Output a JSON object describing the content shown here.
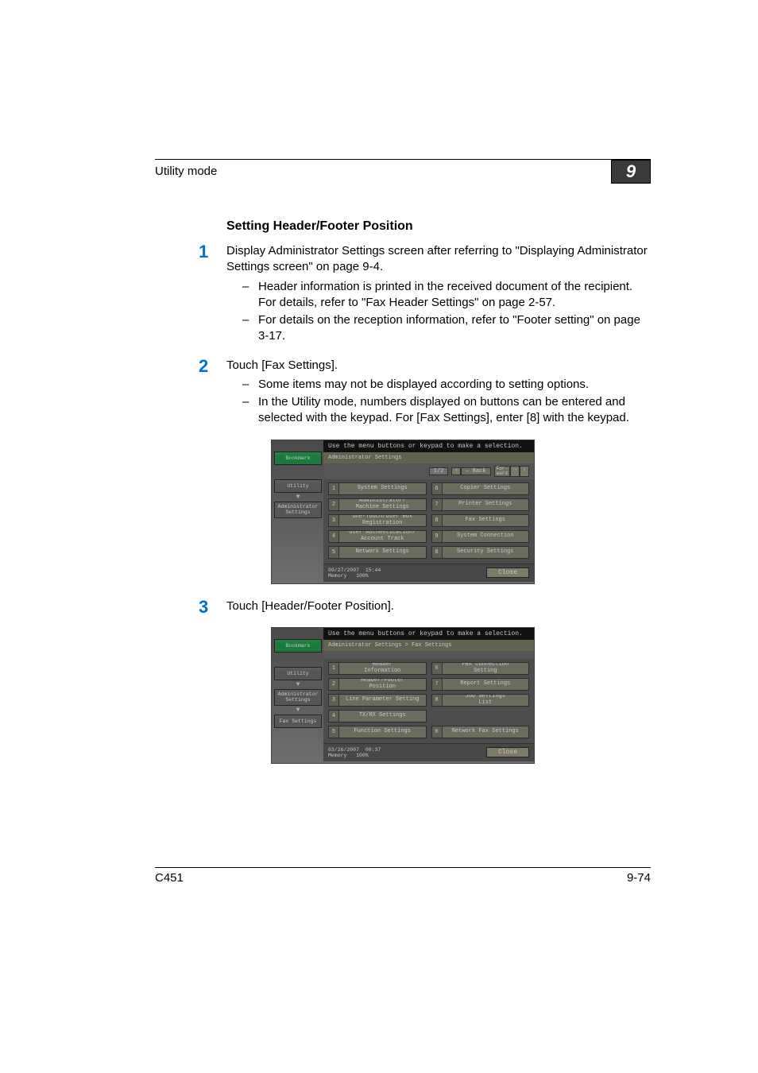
{
  "header": {
    "mode": "Utility mode",
    "chapter": "9"
  },
  "section_heading": "Setting Header/Footer Position",
  "steps": [
    {
      "n": "1",
      "body": "Display Administrator Settings screen after referring to \"Displaying Administrator Settings screen\" on page 9-4.",
      "subs": [
        "Header information is printed in the received document of the recipient. For details, refer to \"Fax Header Settings\" on page 2-57.",
        "For details on the reception information, refer to \"Footer setting\" on page 3-17."
      ]
    },
    {
      "n": "2",
      "body": "Touch [Fax Settings].",
      "subs": [
        "Some items may not be displayed according to setting options.",
        "In the Utility mode, numbers displayed on buttons can be entered and selected with the keypad. For [Fax Settings], enter [8] with the keypad."
      ]
    },
    {
      "n": "3",
      "body": "Touch [Header/Footer Position].",
      "subs": []
    }
  ],
  "shot_common": {
    "instruction": "Use the menu buttons or keypad to make a selection.",
    "bookmark": "Bookmark",
    "utility": "Utility",
    "admin": "Administrator Settings",
    "fax_settings": "Fax Settings",
    "back": "← Back",
    "forward_label": "For-\nward",
    "close": "Close",
    "memory_label": "Memory",
    "memory_value": "100%"
  },
  "shot1": {
    "breadcrumb": "Administrator Settings",
    "page": "1/2",
    "items_left": [
      {
        "n": "1",
        "l": "System Settings"
      },
      {
        "n": "2",
        "l": "Administrator/\nMachine Settings"
      },
      {
        "n": "3",
        "l": "One-Touch/User Box\nRegistration"
      },
      {
        "n": "4",
        "l": "User Authentication/\nAccount Track"
      },
      {
        "n": "5",
        "l": "Network Settings"
      }
    ],
    "items_right": [
      {
        "n": "6",
        "l": "Copier Settings"
      },
      {
        "n": "7",
        "l": "Printer Settings"
      },
      {
        "n": "8",
        "l": "Fax Settings"
      },
      {
        "n": "9",
        "l": "System Connection"
      },
      {
        "n": "0",
        "l": "Security Settings"
      }
    ],
    "date": "09/27/2007",
    "time": "15:44"
  },
  "shot2": {
    "breadcrumb": "Administrator Settings  > Fax Settings",
    "items_left": [
      {
        "n": "1",
        "l": "Header\nInformation"
      },
      {
        "n": "2",
        "l": "Header/Footer\nPosition"
      },
      {
        "n": "3",
        "l": "Line Parameter Setting"
      },
      {
        "n": "4",
        "l": "TX/RX Settings"
      },
      {
        "n": "5",
        "l": "Function Settings"
      }
    ],
    "items_right": [
      {
        "n": "6",
        "l": "PBX Connection\nSetting"
      },
      {
        "n": "7",
        "l": "Report Settings"
      },
      {
        "n": "8",
        "l": "Job Settings\nList"
      },
      {
        "n": "0",
        "l": "Network Fax Settings"
      }
    ],
    "date": "03/26/2007",
    "time": "00:37"
  },
  "footer": {
    "model": "C451",
    "page": "9-74"
  }
}
